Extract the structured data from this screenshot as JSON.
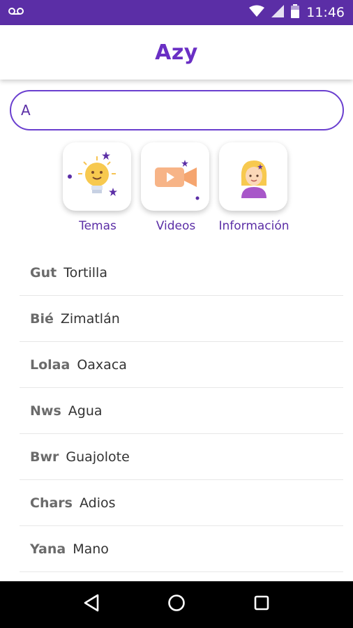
{
  "status_bar": {
    "time": "11:46",
    "icons": [
      "voicemail-icon",
      "wifi-icon",
      "signal-icon",
      "battery-icon"
    ]
  },
  "app_bar": {
    "title": "Azy"
  },
  "search": {
    "value": "A",
    "placeholder": ""
  },
  "categories": [
    {
      "label": "Temas",
      "icon": "lightbulb-icon"
    },
    {
      "label": "Videos",
      "icon": "video-camera-icon"
    },
    {
      "label": "Información",
      "icon": "person-icon"
    }
  ],
  "words": [
    {
      "word": "Gut",
      "translation": "Tortilla"
    },
    {
      "word": "Bié",
      "translation": "Zimatlán"
    },
    {
      "word": "Lolaa",
      "translation": "Oaxaca"
    },
    {
      "word": "Nws",
      "translation": "Agua"
    },
    {
      "word": "Bwr",
      "translation": "Guajolote"
    },
    {
      "word": "Chars",
      "translation": "Adios"
    },
    {
      "word": "Yana",
      "translation": "Mano"
    }
  ],
  "nav": {
    "icons": [
      "back-icon",
      "home-icon",
      "recents-icon"
    ]
  },
  "colors": {
    "brand": "#5b2ea6",
    "accent": "#6a2fc4"
  }
}
